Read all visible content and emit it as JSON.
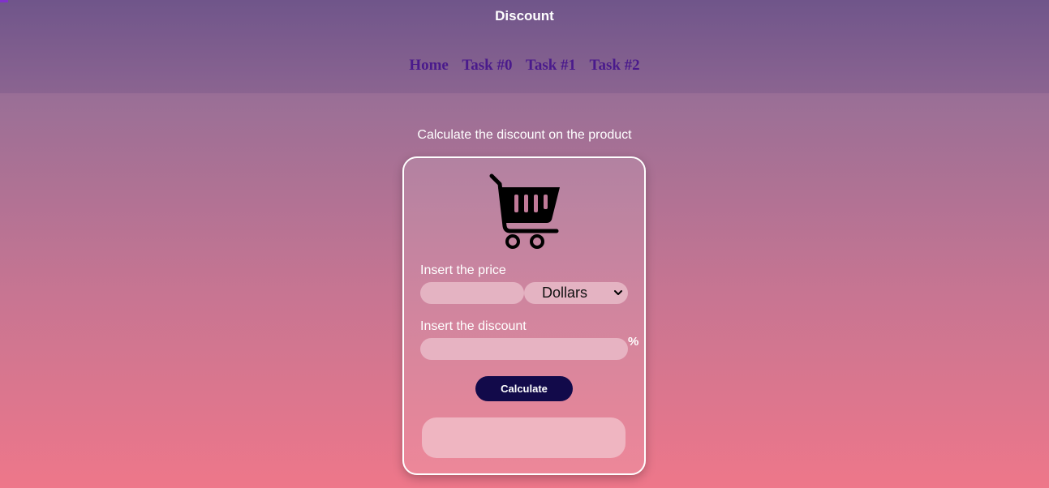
{
  "header": {
    "title": "Discount",
    "nav": [
      {
        "label": "Home"
      },
      {
        "label": "Task #0"
      },
      {
        "label": "Task #1"
      },
      {
        "label": "Task #2"
      }
    ]
  },
  "main": {
    "subtitle": "Calculate the discount on the product",
    "card": {
      "icon": "shopping-cart-icon",
      "price_label": "Insert the price",
      "price_value": "",
      "currency_selected": "Dollars",
      "discount_label": "Insert the discount",
      "discount_value": "",
      "percent_sign": "%",
      "calculate_label": "Calculate",
      "result": ""
    }
  },
  "colors": {
    "nav_link": "#4a1a8c",
    "button": "#120a4a",
    "input_bg": "#e4b3c2"
  }
}
